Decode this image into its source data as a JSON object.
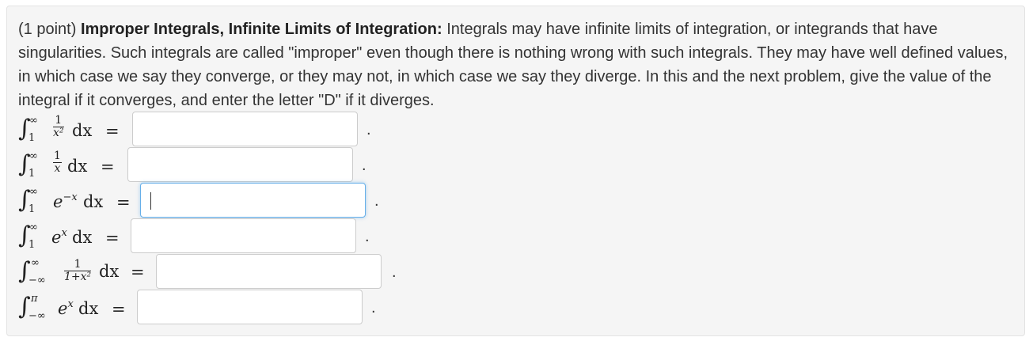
{
  "problem": {
    "points_label": "(1 point)",
    "title": "Improper Integrals, Infinite Limits of Integration:",
    "body": "Integrals may have infinite limits of integration, or integrands that have singularities. Such integrals are called \"improper\" even though there is nothing wrong with such integrals. They may have well defined values, in which case we say they converge, or they may not, in which case we say they diverge. In this and the next problem, give the value of the integral if it converges, and enter the letter \"D\" if it diverges."
  },
  "integrals": [
    {
      "lower": "1",
      "upper": "∞",
      "integrand": "1/x^2",
      "answer": ""
    },
    {
      "lower": "1",
      "upper": "∞",
      "integrand": "1/x",
      "answer": ""
    },
    {
      "lower": "1",
      "upper": "∞",
      "integrand": "e^{-x}",
      "answer": ""
    },
    {
      "lower": "1",
      "upper": "∞",
      "integrand": "e^{x}",
      "answer": ""
    },
    {
      "lower": "−∞",
      "upper": "∞",
      "integrand": "1/(1+x^2)",
      "answer": ""
    },
    {
      "lower": "−∞",
      "upper": "π",
      "integrand": "e^{x}",
      "answer": ""
    }
  ],
  "symbols": {
    "integral": "∫",
    "dx": "dx",
    "equals": "=",
    "period": "."
  },
  "fractions": {
    "f1": {
      "num": "1",
      "den": "x²"
    },
    "f2": {
      "num": "1",
      "den": "x"
    },
    "f5": {
      "num": "1",
      "den": "1+x²"
    }
  },
  "exponentials": {
    "e3": {
      "base": "e",
      "exp": "−x"
    },
    "e4": {
      "base": "e",
      "exp": "x"
    },
    "e6": {
      "base": "e",
      "exp": "x"
    }
  }
}
